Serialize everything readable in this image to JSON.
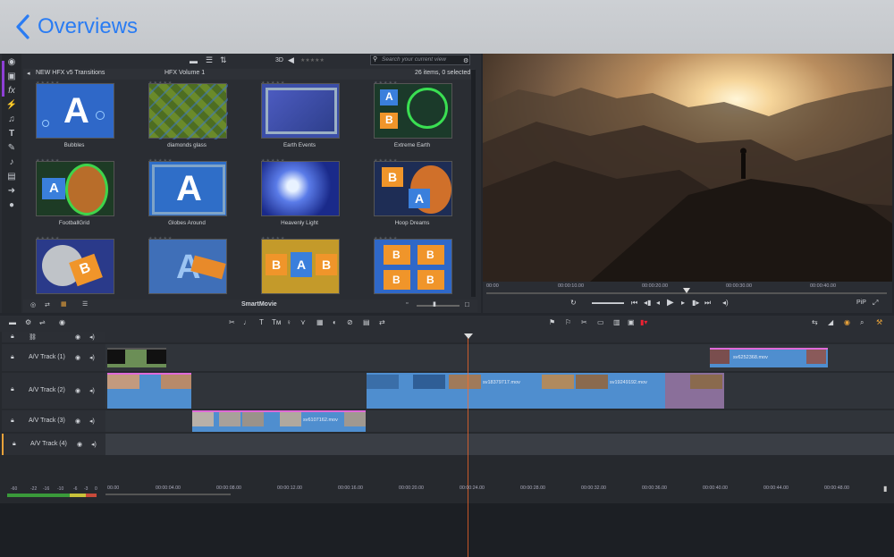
{
  "nav": {
    "back_label": "Overviews"
  },
  "library": {
    "toolbar": {
      "mode_3d": "3D",
      "search_placeholder": "Search your current view"
    },
    "header": {
      "folder": "NEW HFX v5 Transitions",
      "volume": "HFX Volume 1",
      "count": "26 items, 0 selected"
    },
    "items": [
      {
        "label": "Bubbles"
      },
      {
        "label": "diamonds glass"
      },
      {
        "label": "Earth Events"
      },
      {
        "label": "Extreme Earth"
      },
      {
        "label": "FootballGrid"
      },
      {
        "label": "Globes Around"
      },
      {
        "label": "Heavenly Light"
      },
      {
        "label": "Hoop Dreams"
      },
      {
        "label": ""
      },
      {
        "label": ""
      },
      {
        "label": ""
      },
      {
        "label": ""
      }
    ],
    "bottom_label": "SmartMovie"
  },
  "preview": {
    "ruler": [
      "00:00",
      "00:00:10.00",
      "00:00:20.00",
      "00:00:30.00",
      "00:00:40.00"
    ],
    "pip_label": "PiP"
  },
  "timeline": {
    "tracks": [
      {
        "name": "A/V Track (1)"
      },
      {
        "name": "A/V Track (2)"
      },
      {
        "name": "A/V Track (3)"
      },
      {
        "name": "A/V Track (4)"
      }
    ],
    "clips": {
      "c1": "sv6252368.mov",
      "c2": "sv18379717.mov",
      "c3": "sv19249192.mov",
      "c4": "sv6107162.mov"
    },
    "ruler": [
      "00.00",
      "00:00:04.00",
      "00:00:08.00",
      "00:00:12.00",
      "00:00:16.00",
      "00:00:20.00",
      "00:00:24.00",
      "00:00:28.00",
      "00:00:32.00",
      "00:00:36.00",
      "00:00:40.00",
      "00:00:44.00",
      "00:00:48.00"
    ],
    "meter_labels": [
      "-60",
      "-22",
      "-16",
      "-10",
      "-6",
      "-3",
      "0"
    ]
  },
  "colors": {
    "accent": "#2a7cf3",
    "playhead": "#ff6a2a",
    "clip": "#4f8ecf",
    "clip_top": "#e06ad8"
  }
}
